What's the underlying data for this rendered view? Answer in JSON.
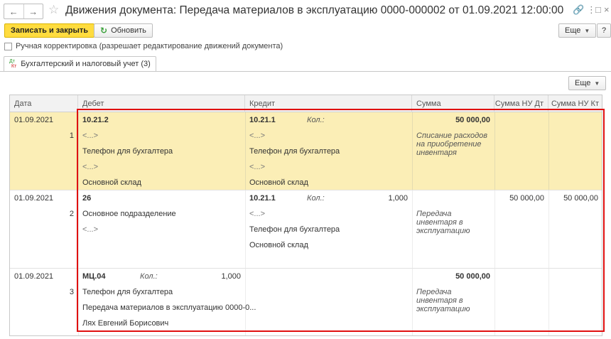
{
  "window": {
    "title": "Движения документа: Передача материалов в эксплуатацию 0000-000002 от 01.09.2021 12:00:00",
    "icons": [
      "arrow-left-icon",
      "arrow-right-icon",
      "star-icon",
      "link-icon",
      "more-vert-icon",
      "maximize-icon",
      "close-icon"
    ]
  },
  "toolbar": {
    "save_close_label": "Записать и закрыть",
    "refresh_label": "Обновить",
    "more_label": "Еще",
    "help_label": "?"
  },
  "manual_edit": {
    "label": "Ручная корректировка (разрешает редактирование движений документа)",
    "checked": false
  },
  "tabs": [
    {
      "icon_top": "Дт",
      "icon_bottom": "Кт",
      "label": "Бухгалтерский и налоговый учет (3)"
    }
  ],
  "table_toolbar": {
    "more_label": "Еще"
  },
  "table": {
    "columns": {
      "date": "Дата",
      "debit": "Дебет",
      "credit": "Кредит",
      "sum": "Сумма",
      "sum_nu_dt": "Сумма НУ Дт",
      "sum_nu_kt": "Сумма НУ Кт"
    },
    "rows": [
      {
        "date": "01.09.2021",
        "num": "1",
        "debit": {
          "account": "10.21.2",
          "lines": [
            "<...>",
            "Телефон для бухгалтера",
            "<...>",
            "Основной склад"
          ]
        },
        "credit": {
          "account": "10.21.1",
          "qty_label": "Кол.:",
          "qty": "",
          "lines": [
            "<...>",
            "Телефон для бухгалтера",
            "<...>",
            "Основной склад"
          ]
        },
        "sum": "50 000,00",
        "content": "Списание расходов на приобретение инвентаря",
        "sum_nu_dt": "",
        "sum_nu_kt": ""
      },
      {
        "date": "01.09.2021",
        "num": "2",
        "debit": {
          "account": "26",
          "lines": [
            "Основное подразделение",
            "<...>"
          ]
        },
        "credit": {
          "account": "10.21.1",
          "qty_label": "Кол.:",
          "qty": "1,000",
          "lines": [
            "<...>",
            "Телефон для бухгалтера",
            "Основной склад"
          ]
        },
        "sum": "",
        "content": "Передача инвентаря в эксплуатацию",
        "sum_nu_dt": "50 000,00",
        "sum_nu_kt": "50 000,00"
      },
      {
        "date": "01.09.2021",
        "num": "3",
        "debit": {
          "account": "МЦ.04",
          "qty_label": "Кол.:",
          "qty": "1,000",
          "lines": [
            "Телефон для бухгалтера",
            "Передача материалов в эксплуатацию 0000-0...",
            "Лях Евгений Борисович"
          ]
        },
        "credit": {
          "account": "",
          "lines": []
        },
        "sum": "50 000,00",
        "content": "Передача инвентаря в эксплуатацию",
        "sum_nu_dt": "",
        "sum_nu_kt": ""
      }
    ]
  },
  "colors": {
    "primary_button": "#ffdc3f",
    "selected_row": "#fbeeb6",
    "highlight_border": "#e01010"
  }
}
